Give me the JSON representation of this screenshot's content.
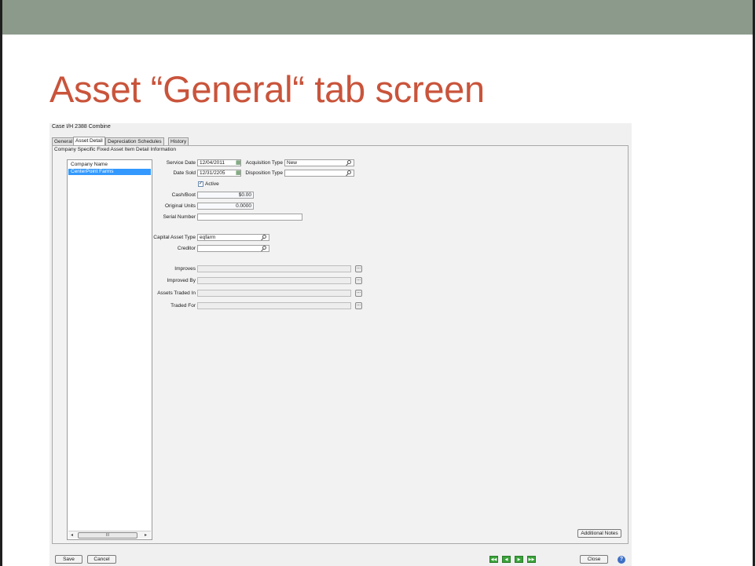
{
  "slide": {
    "title": "Asset “General“ tab screen"
  },
  "app": {
    "title": "Case I/H 2388 Combine"
  },
  "tabs": [
    {
      "label": "General"
    },
    {
      "label": "Asset Detail"
    },
    {
      "label": "Depreciation Schedules"
    },
    {
      "label": "History"
    }
  ],
  "panel": {
    "header": "Company Specific Fixed Asset Item Detail Information"
  },
  "companies": {
    "header": "Company Name",
    "rows": [
      "CenterPoint Farms"
    ],
    "scroll_thumb": "III"
  },
  "form": {
    "service_date": {
      "label": "Service Date",
      "value": "12/04/2011"
    },
    "acquisition_type": {
      "label": "Acquisition Type",
      "value": "New"
    },
    "date_sold": {
      "label": "Date Sold",
      "value": "12/31/2205"
    },
    "disposition_type": {
      "label": "Disposition Type",
      "value": ""
    },
    "active": {
      "label": "Active",
      "checked": true
    },
    "cash_boot": {
      "label": "Cash/Boot",
      "value": "$0.00"
    },
    "original_units": {
      "label": "Original Units",
      "value": "0.0000"
    },
    "serial_number": {
      "label": "Serial Number",
      "value": ""
    },
    "capital_asset_type": {
      "label": "Capital Asset Type",
      "value": "eqfarm"
    },
    "creditor": {
      "label": "Creditor",
      "value": ""
    },
    "improves": {
      "label": "Improves",
      "value": ""
    },
    "improved_by": {
      "label": "Improved By",
      "value": ""
    },
    "assets_traded_in": {
      "label": "Assets Traded In",
      "value": ""
    },
    "traded_for": {
      "label": "Traded For",
      "value": ""
    }
  },
  "buttons": {
    "ellipsis": "...",
    "additional_notes": "Additional Notes",
    "save": "Save",
    "cancel": "Cancel",
    "close": "Close",
    "help": "?"
  },
  "icons": {
    "calendar": "calendar-icon",
    "lookup": "magnifier-icon",
    "nav": [
      "first-record-icon",
      "previous-record-icon",
      "next-record-icon",
      "last-record-icon"
    ]
  },
  "colors": {
    "title": "#c9543b",
    "top_bar": "#8c9a8b",
    "selection": "#3399ff",
    "nav_green": "#3aa33a"
  }
}
